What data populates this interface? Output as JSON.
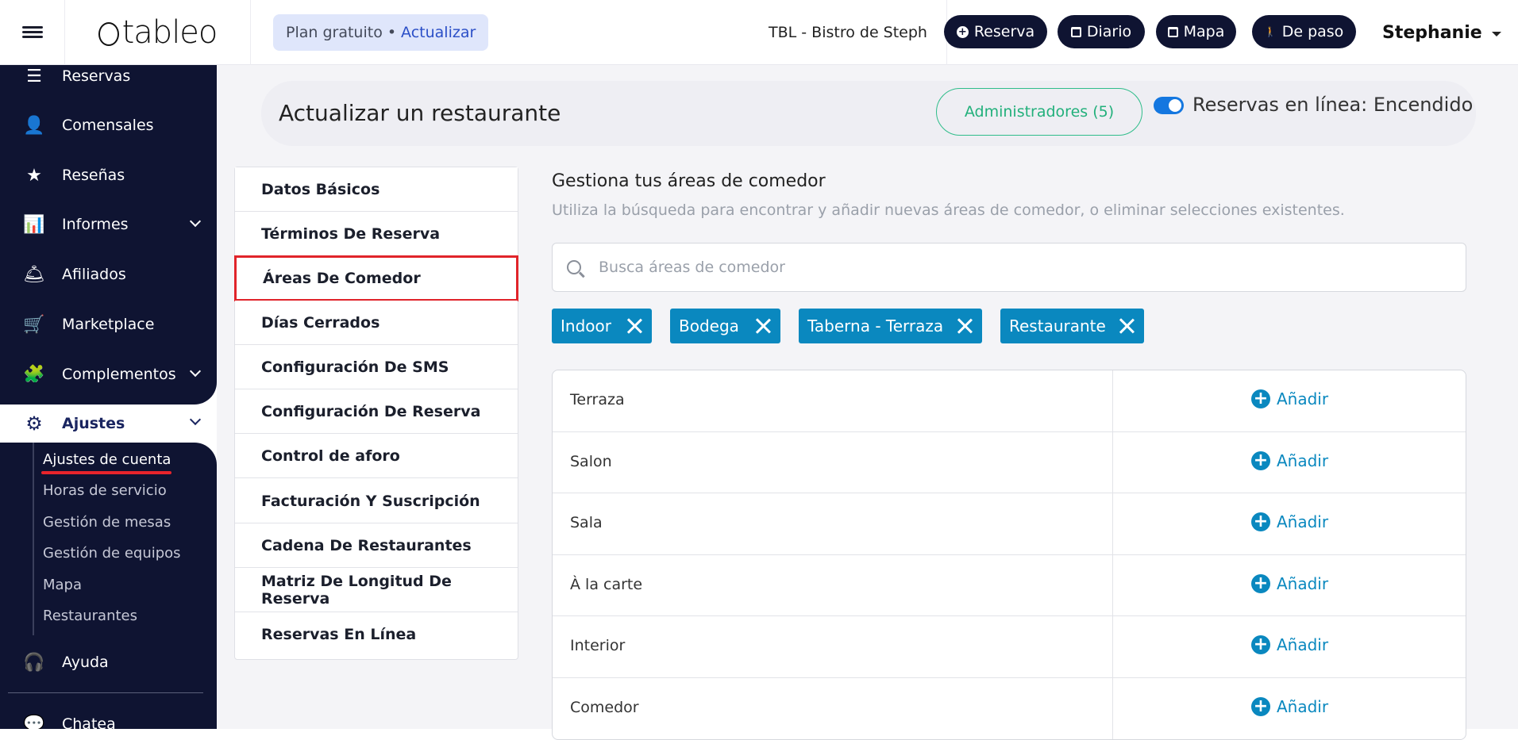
{
  "header": {
    "logo_text": "tableo",
    "plan_label": "Plan gratuito",
    "plan_separator": "•",
    "upgrade_label": "Actualizar",
    "restaurant_name": "TBL - Bistro de Steph",
    "buttons": [
      {
        "label": "Reserva",
        "icon": "plus-circle-icon"
      },
      {
        "label": "Diario",
        "icon": "calendar-icon"
      },
      {
        "label": "Mapa",
        "icon": "calendar-icon"
      },
      {
        "label": "De paso",
        "icon": "walking-icon"
      }
    ],
    "user_name": "Stephanie"
  },
  "sidebar": {
    "items": [
      {
        "label": "Reservas",
        "icon": "list-icon"
      },
      {
        "label": "Comensales",
        "icon": "user-icon"
      },
      {
        "label": "Reseñas",
        "icon": "star-icon"
      },
      {
        "label": "Informes",
        "icon": "bar-chart-icon"
      },
      {
        "label": "Afiliados",
        "icon": "bell-icon"
      },
      {
        "label": "Marketplace",
        "icon": "cart-icon"
      },
      {
        "label": "Complementos",
        "icon": "puzzle-icon"
      }
    ],
    "active": {
      "label": "Ajustes",
      "icon": "gear-icon"
    },
    "submenu": [
      {
        "label": "Ajustes de cuenta",
        "active": true
      },
      {
        "label": "Horas de servicio"
      },
      {
        "label": "Gestión de mesas"
      },
      {
        "label": "Gestión de equipos"
      },
      {
        "label": "Mapa"
      },
      {
        "label": "Restaurantes"
      }
    ],
    "help": {
      "label": "Ayuda",
      "icon": "headset-icon"
    },
    "chat": {
      "label": "Chateа",
      "icon": "chat-icon"
    }
  },
  "page": {
    "title": "Actualizar un restaurante",
    "admins_button": "Administradores (5)",
    "online_label": "Reservas en línea: Encendido",
    "online_enabled": true
  },
  "tabs": [
    "Datos Básicos",
    "Términos De Reserva",
    "Áreas De Comedor",
    "Días Cerrados",
    "Configuración De SMS",
    "Configuración De Reserva",
    "Control de aforo",
    "Facturación Y Suscripción",
    "Cadena De Restaurantes",
    "Matriz De Longitud De Reserva",
    "Reservas En Línea"
  ],
  "selected_tab": "Áreas De Comedor",
  "dining": {
    "title": "Gestiona tus áreas de comedor",
    "subtitle": "Utiliza la búsqueda para encontrar y añadir nuevas áreas de comedor, o eliminar selecciones existentes.",
    "search_placeholder": "Busca áreas de comedor",
    "selected_tags": [
      "Indoor",
      "Bodega",
      "Taberna - Terraza",
      "Restaurante"
    ],
    "add_label": "Añadir",
    "available_areas": [
      "Terraza",
      "Salon",
      "Sala",
      "À la carte",
      "Interior",
      "Comedor"
    ]
  },
  "colors": {
    "sidebar_bg": "#0f1432",
    "accent_teal": "#0a88bf",
    "highlight_red": "#e0242a",
    "admins_green": "#22b07b",
    "toggle_blue": "#1477e0"
  }
}
